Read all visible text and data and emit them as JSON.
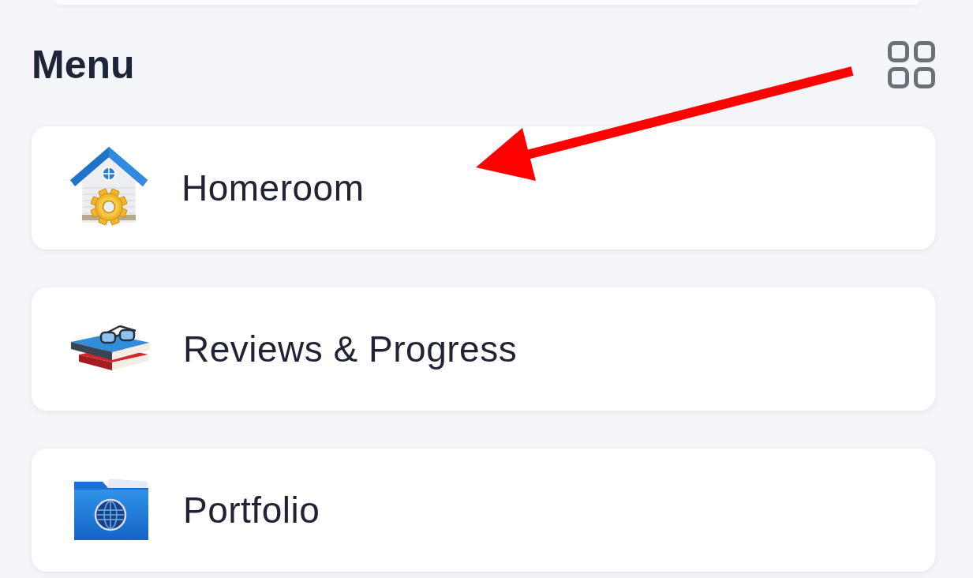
{
  "menu": {
    "title": "Menu",
    "items": [
      {
        "label": "Homeroom"
      },
      {
        "label": "Reviews & Progress"
      },
      {
        "label": "Portfolio"
      }
    ]
  }
}
